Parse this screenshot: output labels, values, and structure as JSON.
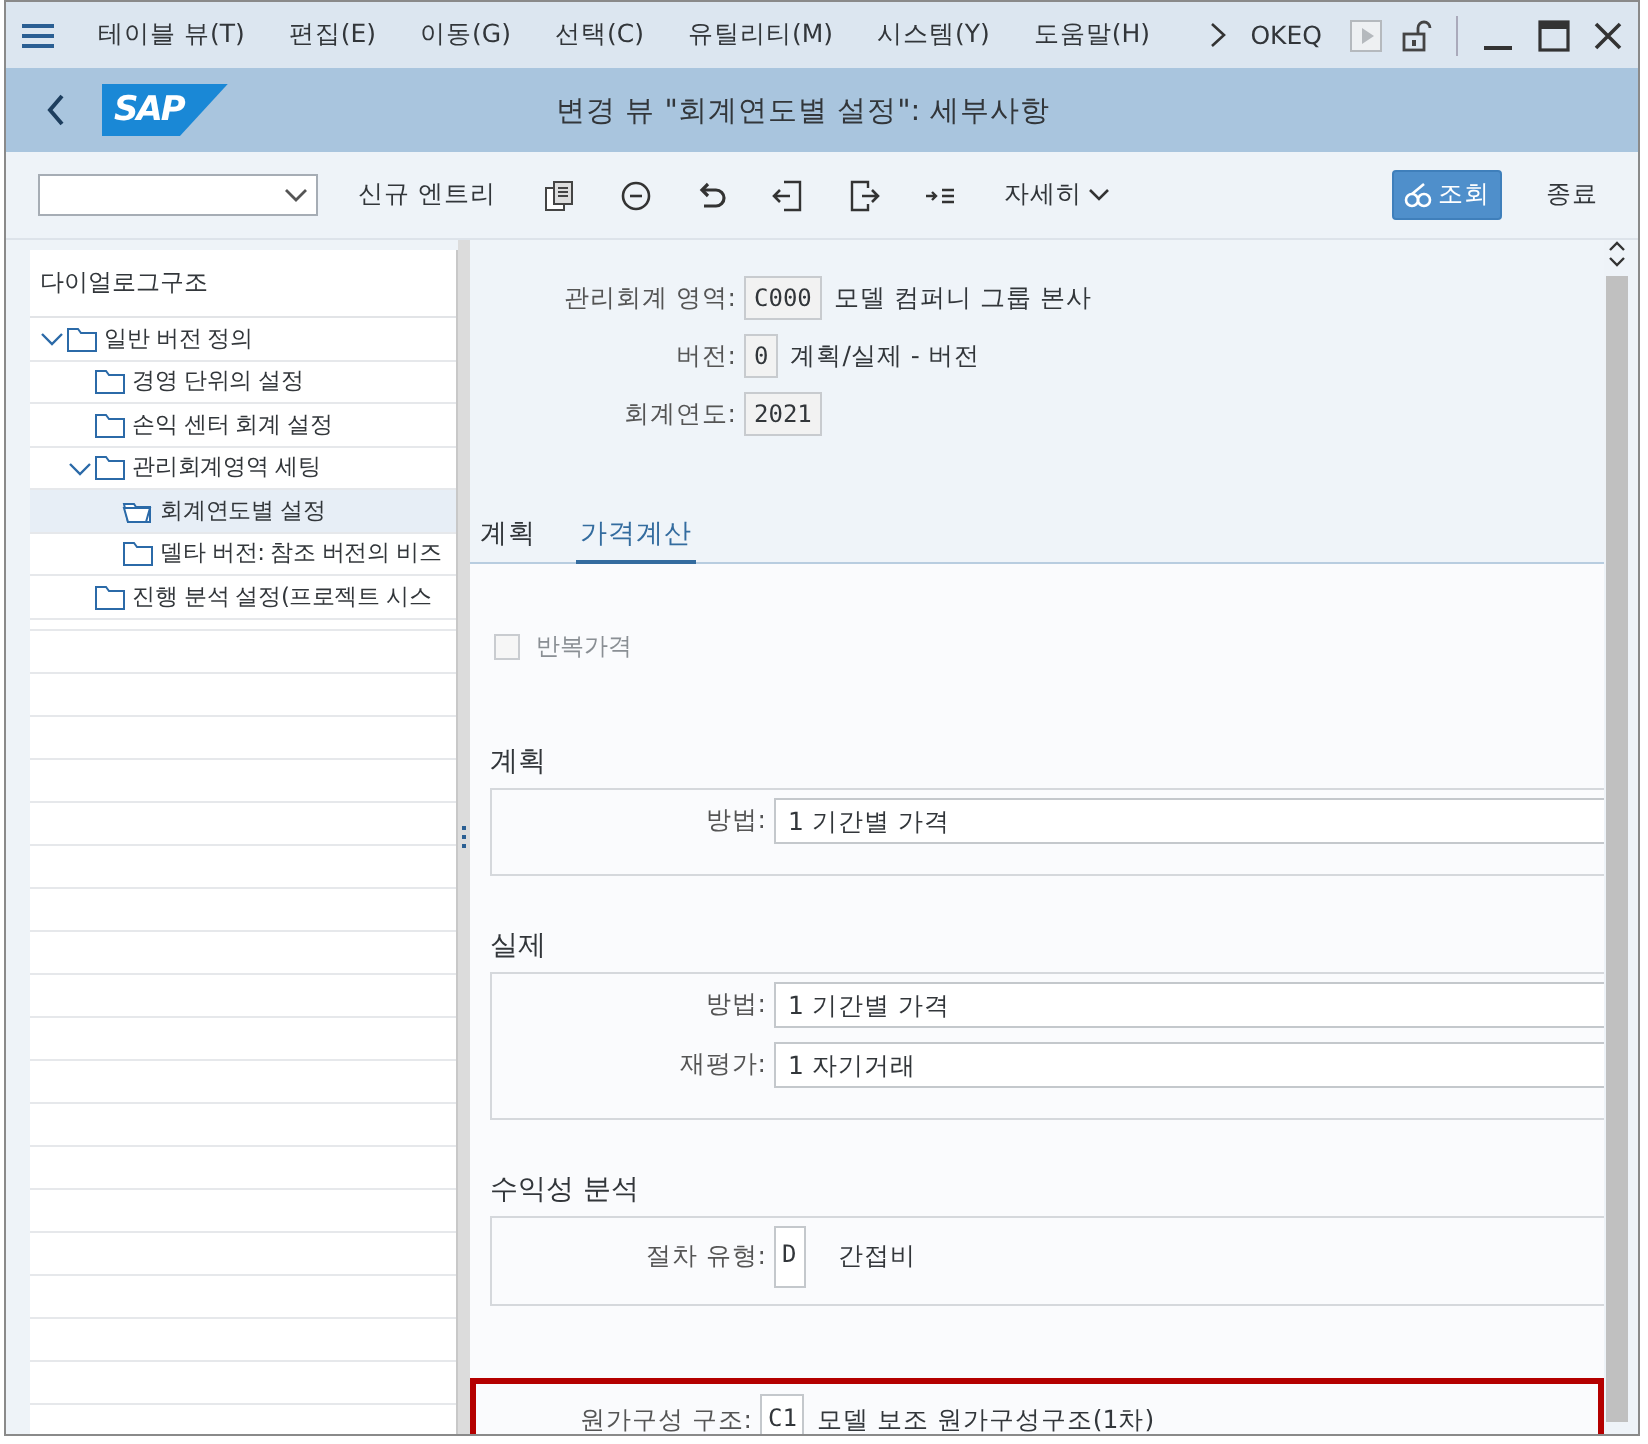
{
  "menu": {
    "items": [
      "테이블 뷰(T)",
      "편집(E)",
      "이동(G)",
      "선택(C)",
      "유틸리티(M)",
      "시스템(Y)",
      "도움말(H)"
    ],
    "transaction": "OKEQ"
  },
  "title_bar": {
    "logo": "SAP",
    "title": "변경 뷰 \"회계연도별 설정\": 세부사항"
  },
  "toolbar": {
    "new_entry": "신규 엔트리",
    "details": "자세히",
    "display": "조회",
    "exit": "종료"
  },
  "tree": {
    "header": "다이얼로그구조",
    "items": [
      {
        "label": "일반 버전 정의",
        "expanded": true,
        "selected": false,
        "children": [
          {
            "label": "경영 단위의 설정",
            "selected": false
          },
          {
            "label": "손익 센터 회계 설정",
            "selected": false
          },
          {
            "label": "관리회계영역 세팅",
            "expanded": true,
            "selected": false,
            "children": [
              {
                "label": "회계연도별 설정",
                "selected": true
              },
              {
                "label": "델타 버전: 참조 버전의 비즈",
                "selected": false
              }
            ]
          },
          {
            "label": "진행 분석 설정(프로젝트 시스",
            "selected": false
          }
        ]
      }
    ]
  },
  "header_fields": [
    {
      "label": "관리회계 영역:",
      "value": "C000",
      "description": "모델 컴퍼니 그룹 본사"
    },
    {
      "label": "버전:",
      "value": "0",
      "description": "계획/실제 - 버전"
    },
    {
      "label": "회계연도:",
      "value": "2021"
    }
  ],
  "tabs": [
    {
      "label": "계획",
      "selected": false
    },
    {
      "label": "가격계산",
      "selected": true
    }
  ],
  "checkbox": {
    "label": "반복가격",
    "checked": false,
    "disabled": true
  },
  "groups": [
    {
      "title": "계획",
      "fields": [
        {
          "kind": "wide",
          "label": "방법:",
          "value": "1 기간별 가격"
        }
      ]
    },
    {
      "title": "실제",
      "fields": [
        {
          "kind": "wide",
          "label": "방법:",
          "value": "1 기간별 가격"
        },
        {
          "kind": "wide",
          "label": "재평가:",
          "value": "1 자기거래"
        }
      ]
    },
    {
      "title": "수익성 분석",
      "fields": [
        {
          "kind": "short",
          "label": "절차 유형:",
          "value": "D",
          "description": "간접비"
        }
      ]
    }
  ],
  "cost_component": {
    "label": "원가구성 구조:",
    "value": "C1",
    "description": "모델 보조 원가구성구조(1차)",
    "highlighted": true
  }
}
